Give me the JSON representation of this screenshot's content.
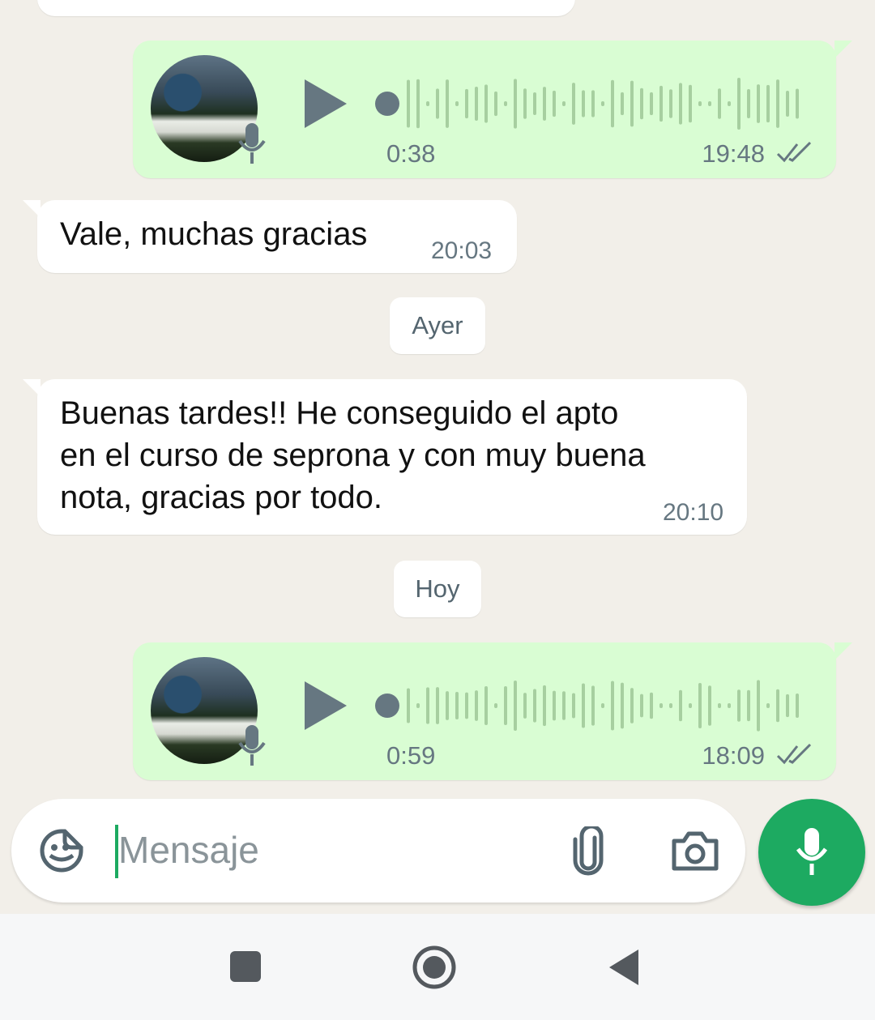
{
  "colors": {
    "background": "#f2efe9",
    "incoming_bubble": "#ffffff",
    "outgoing_bubble": "#d9fdd3",
    "accent_green": "#1daa61",
    "meta_gray": "#667781"
  },
  "messages": {
    "voice1": {
      "duration": "0:38",
      "time": "19:48",
      "status_icon": "double-check-icon"
    },
    "text1": {
      "text": "Vale, muchas gracias",
      "time": "20:03"
    },
    "date_ayer": "Ayer",
    "text2": {
      "lines": [
        "Buenas tardes!! He conseguido el apto",
        "en el curso de seprona y con muy buena",
        "nota, gracias por todo."
      ],
      "time": "20:10"
    },
    "date_hoy": "Hoy",
    "voice2": {
      "duration": "0:59",
      "time": "18:09",
      "status_icon": "double-check-icon"
    }
  },
  "composer": {
    "placeholder": "Mensaje",
    "icons": [
      "sticker-icon",
      "attach-icon",
      "camera-icon",
      "mic-icon"
    ]
  },
  "navigation": {
    "icons": [
      "recents-square-icon",
      "home-circle-icon",
      "back-triangle-icon"
    ]
  }
}
